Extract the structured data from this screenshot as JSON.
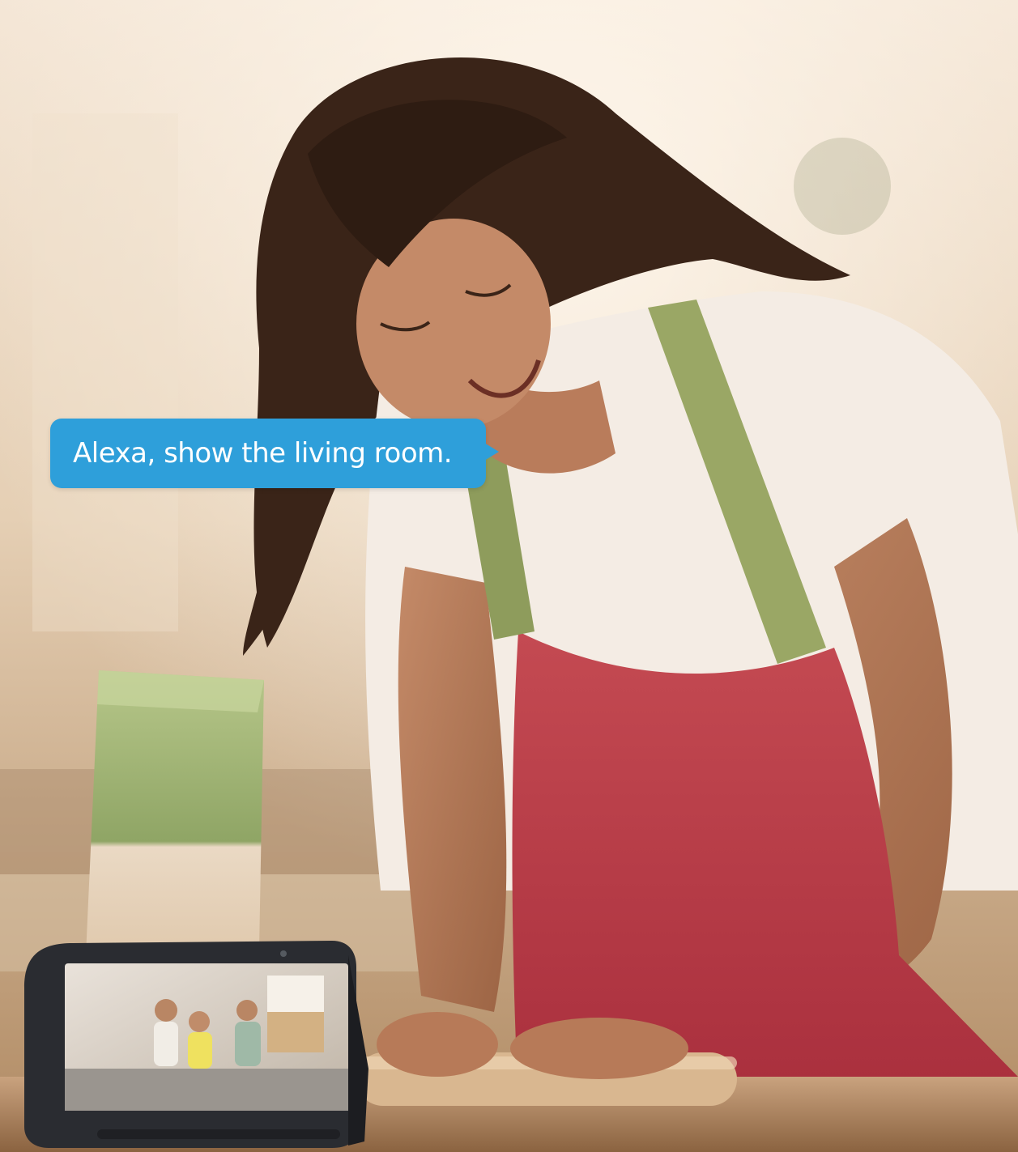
{
  "speech_bubble": {
    "text": "Alexa, show the living room."
  },
  "colors": {
    "bubble": "#2e9fda",
    "apron": "#c93f4c",
    "apron_strap": "#9aa765",
    "shirt": "#f4ece4",
    "device_body": "#2a2c31"
  },
  "icons": {
    "device": "smart-display-device",
    "bubble_tail": "speech-bubble-tail"
  }
}
